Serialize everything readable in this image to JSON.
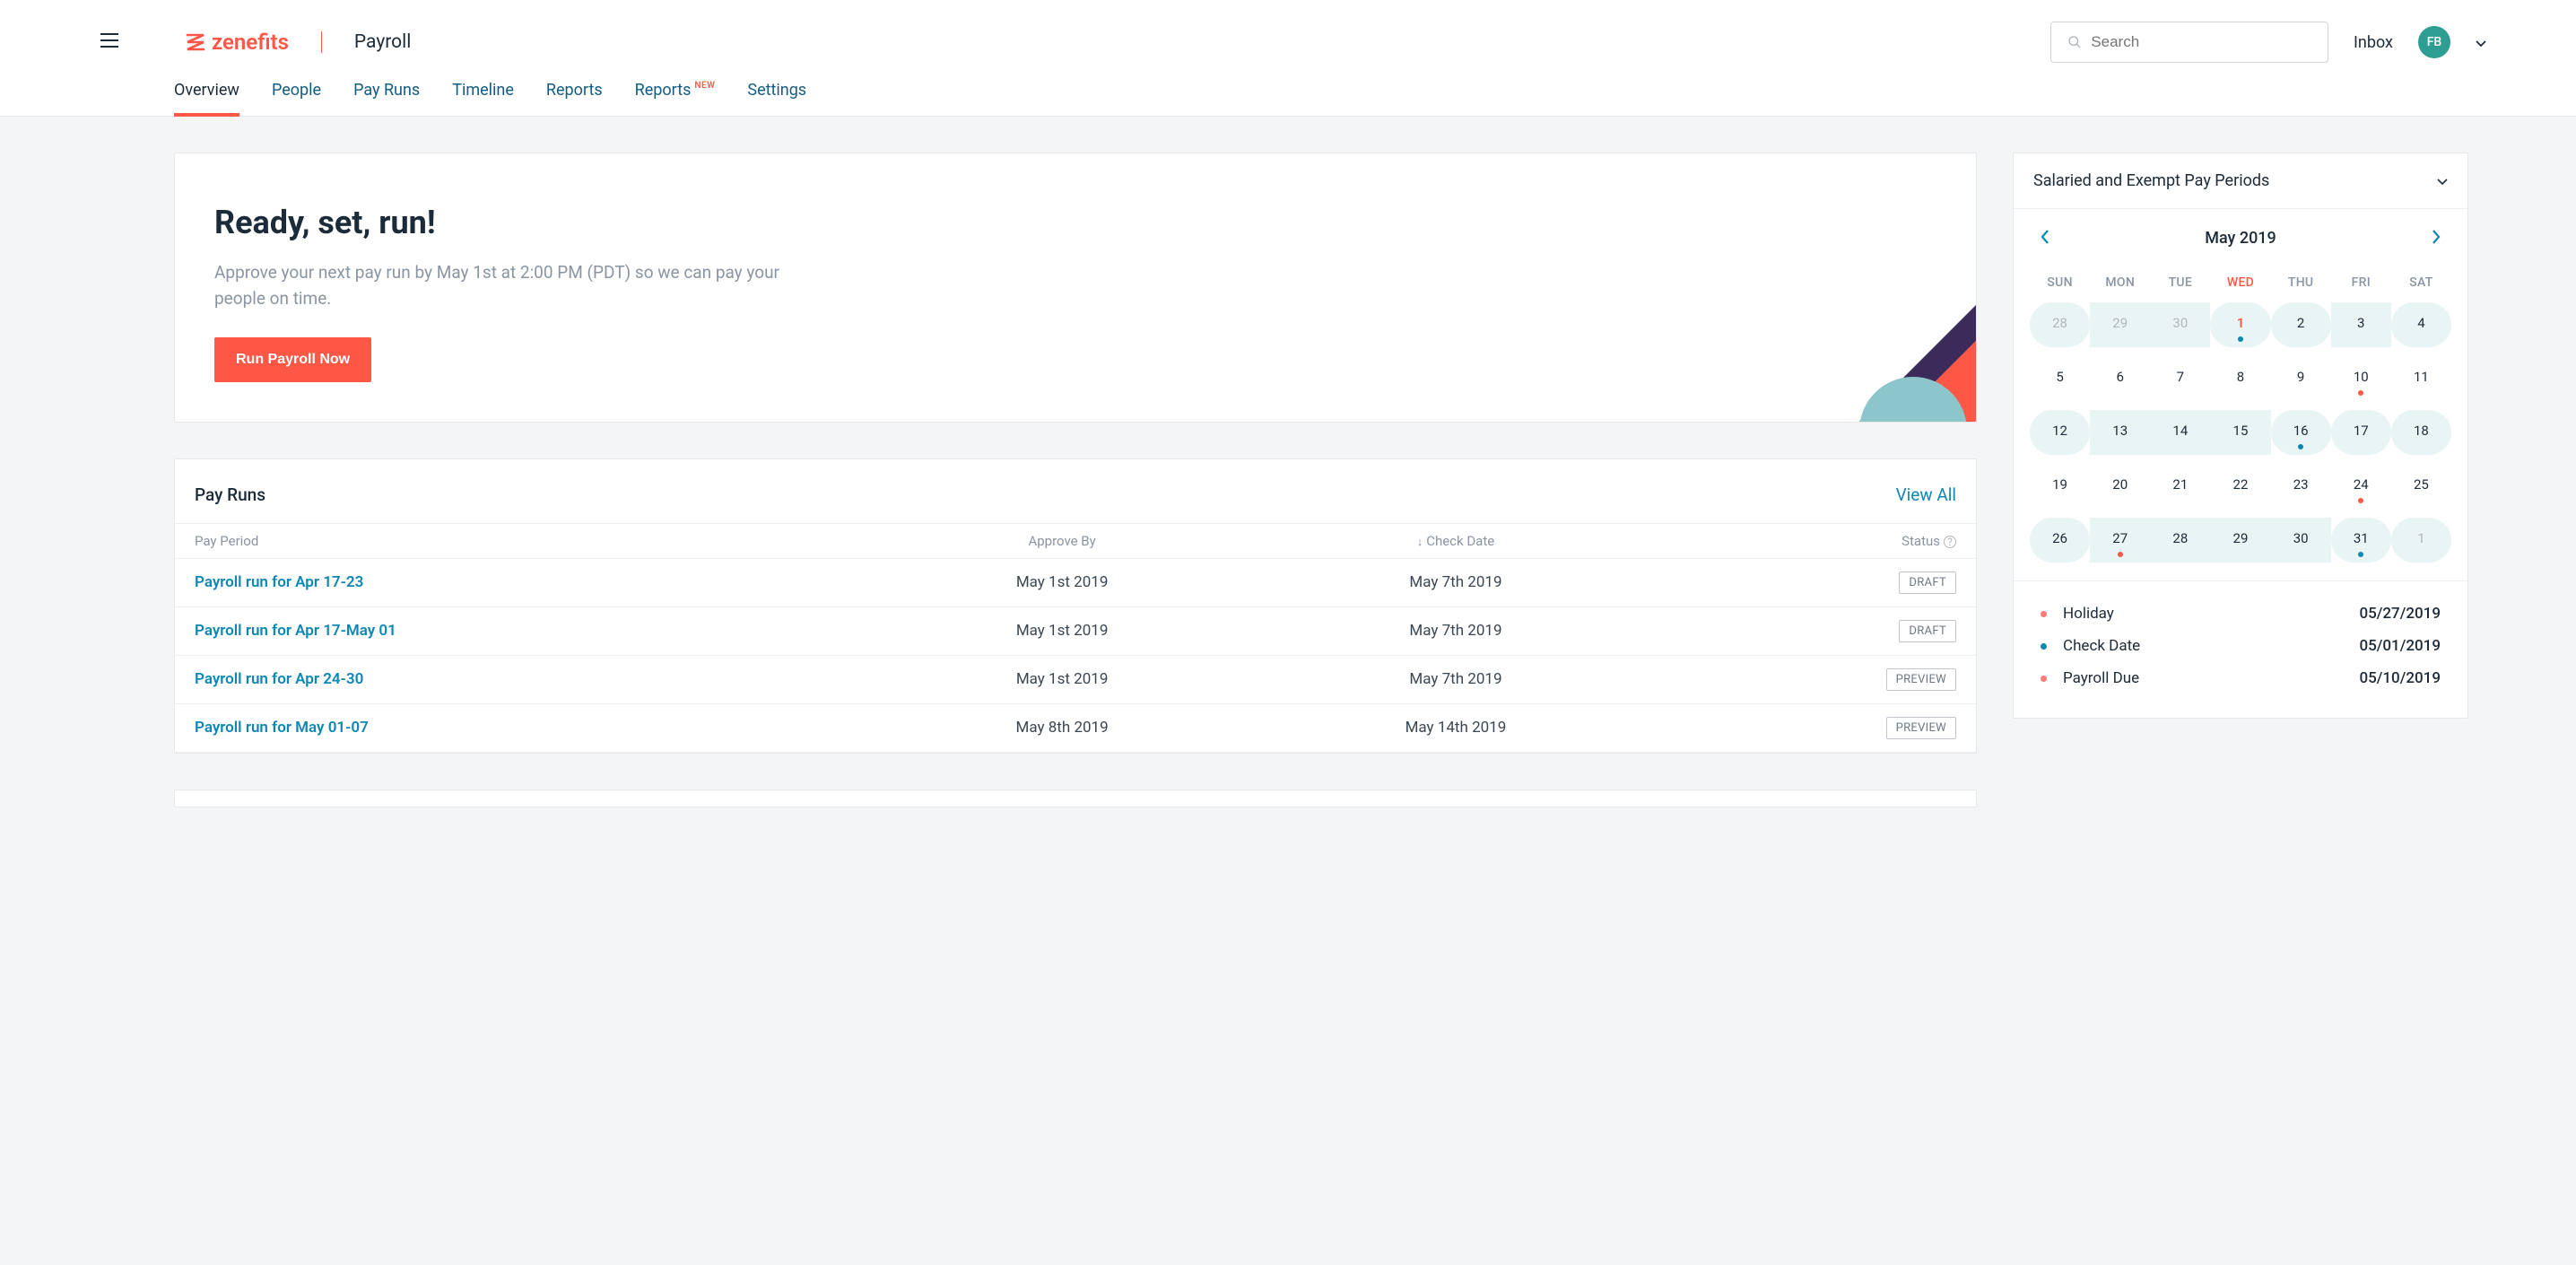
{
  "header": {
    "brand": "zenefits",
    "app_title": "Payroll",
    "search_placeholder": "Search",
    "inbox_label": "Inbox",
    "avatar_initials": "FB"
  },
  "tabs": {
    "overview": "Overview",
    "people": "People",
    "pay_runs": "Pay Runs",
    "timeline": "Timeline",
    "reports": "Reports",
    "reports_new": "Reports",
    "reports_new_badge": "NEW",
    "settings": "Settings"
  },
  "hero": {
    "title": "Ready, set, run!",
    "subtitle": "Approve your next pay run by May 1st at 2:00 PM (PDT) so we can pay your people on time.",
    "cta": "Run Payroll Now"
  },
  "payruns_panel": {
    "title": "Pay Runs",
    "view_all": "View All",
    "cols": {
      "period": "Pay Period",
      "approve_by": "Approve By",
      "check_date": "Check Date",
      "status": "Status"
    },
    "rows": [
      {
        "period": "Payroll run for Apr 17-23",
        "approve_by": "May 1st 2019",
        "check_date": "May 7th 2019",
        "status": "DRAFT"
      },
      {
        "period": "Payroll run for Apr 17-May 01",
        "approve_by": "May 1st 2019",
        "check_date": "May 7th 2019",
        "status": "DRAFT"
      },
      {
        "period": "Payroll run for Apr 24-30",
        "approve_by": "May 1st 2019",
        "check_date": "May 7th 2019",
        "status": "PREVIEW"
      },
      {
        "period": "Payroll run for May 01-07",
        "approve_by": "May 8th 2019",
        "check_date": "May 14th 2019",
        "status": "PREVIEW"
      }
    ]
  },
  "calendar": {
    "title": "Salaried and Exempt Pay Periods",
    "month_label": "May 2019",
    "day_headers": [
      "SUN",
      "MON",
      "TUE",
      "WED",
      "THU",
      "FRI",
      "SAT"
    ],
    "today_header_index": 3,
    "weeks": [
      [
        {
          "n": "28",
          "muted": true,
          "range_pos": "start"
        },
        {
          "n": "29",
          "muted": true,
          "range_pos": "mid"
        },
        {
          "n": "30",
          "muted": true,
          "range_pos": "mid"
        },
        {
          "n": "1",
          "today": true,
          "dot": "blue",
          "range_pos": "end"
        },
        {
          "n": "2",
          "range_pos": "start"
        },
        {
          "n": "3",
          "range_pos": "mid"
        },
        {
          "n": "4",
          "range_pos": "end"
        }
      ],
      [
        {
          "n": "5"
        },
        {
          "n": "6"
        },
        {
          "n": "7"
        },
        {
          "n": "8"
        },
        {
          "n": "9"
        },
        {
          "n": "10",
          "dot": "red"
        },
        {
          "n": "11"
        }
      ],
      [
        {
          "n": "12",
          "range_pos": "start"
        },
        {
          "n": "13",
          "range_pos": "mid"
        },
        {
          "n": "14",
          "range_pos": "mid"
        },
        {
          "n": "15",
          "range_pos": "mid"
        },
        {
          "n": "16",
          "dot": "blue",
          "range_pos": "end"
        },
        {
          "n": "17",
          "range_pos": "start"
        },
        {
          "n": "18",
          "range_pos": "end"
        }
      ],
      [
        {
          "n": "19"
        },
        {
          "n": "20"
        },
        {
          "n": "21"
        },
        {
          "n": "22"
        },
        {
          "n": "23"
        },
        {
          "n": "24",
          "dot": "red"
        },
        {
          "n": "25"
        }
      ],
      [
        {
          "n": "26",
          "range_pos": "start"
        },
        {
          "n": "27",
          "dot": "red",
          "range_pos": "mid"
        },
        {
          "n": "28",
          "range_pos": "mid"
        },
        {
          "n": "29",
          "range_pos": "mid"
        },
        {
          "n": "30",
          "range_pos": "mid"
        },
        {
          "n": "31",
          "dot": "blue",
          "range_pos": "end"
        },
        {
          "n": "1",
          "muted": true,
          "range_pos": "single"
        }
      ]
    ],
    "legend": [
      {
        "color": "red",
        "label": "Holiday",
        "date": "05/27/2019"
      },
      {
        "color": "blue",
        "label": "Check Date",
        "date": "05/01/2019"
      },
      {
        "color": "red",
        "label": "Payroll Due",
        "date": "05/10/2019"
      }
    ]
  }
}
